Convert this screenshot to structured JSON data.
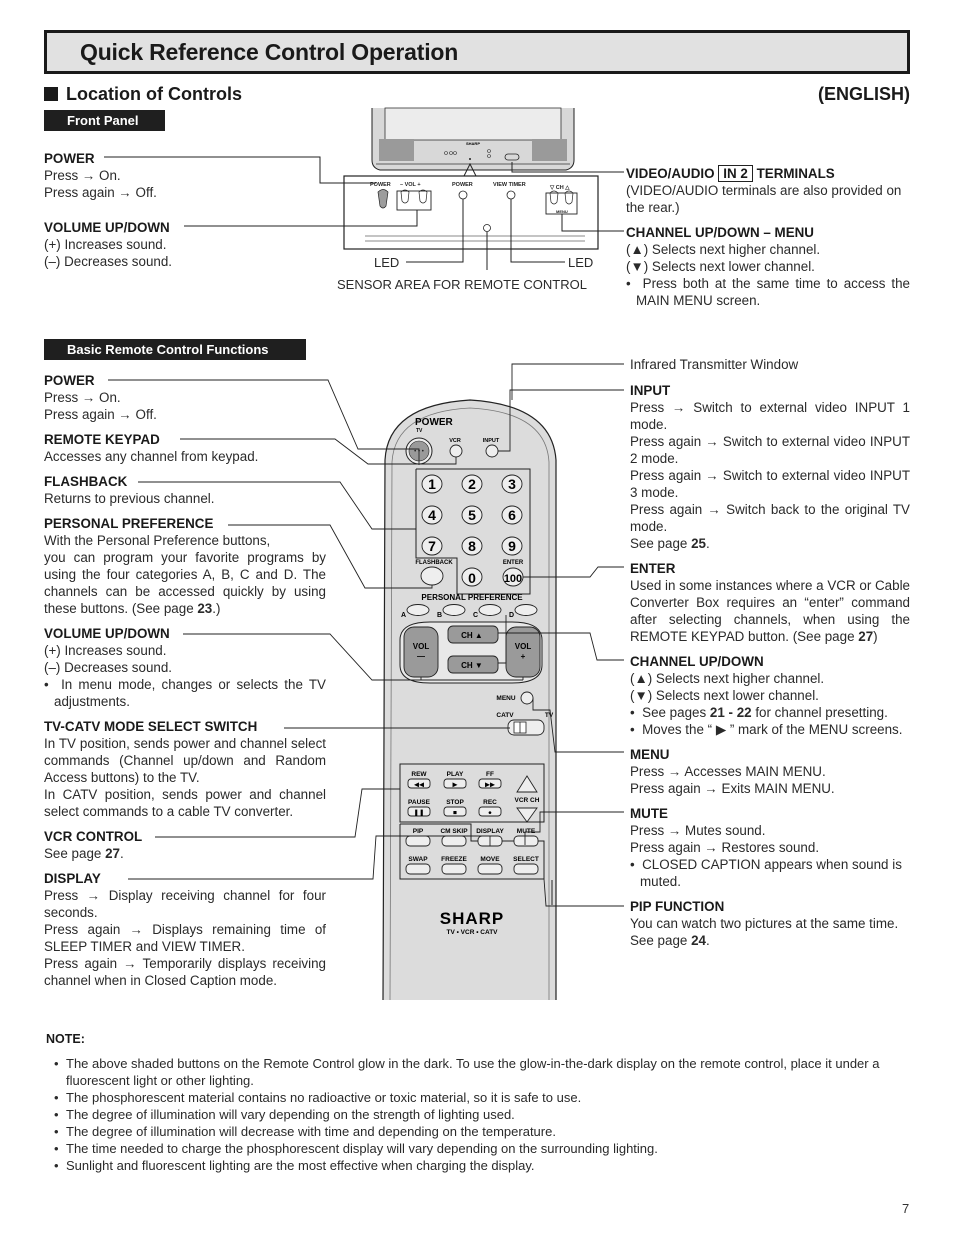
{
  "title": "Quick Reference Control Operation",
  "section": {
    "heading": "Location of Controls",
    "language": "(ENGLISH)"
  },
  "front_panel": {
    "tag": "Front Panel",
    "power": {
      "heading": "POWER",
      "lines": [
        "Press → On.",
        "Press again → Off."
      ]
    },
    "volume": {
      "heading": "VOLUME UP/DOWN",
      "lines": [
        "(+) Increases sound.",
        "(–) Decreases sound."
      ]
    },
    "video_audio": {
      "heading_pre": "VIDEO/AUDIO",
      "heading_box": "IN 2",
      "heading_post": "TERMINALS",
      "lines": [
        "(VIDEO/AUDIO terminals are also provided on the rear.)"
      ]
    },
    "channel": {
      "heading": "CHANNEL UP/DOWN – MENU",
      "lines": [
        "(▲) Selects next higher channel.",
        "(▼) Selects next lower channel."
      ],
      "bullet": "Press both at the same time to access the MAIN MENU screen."
    },
    "led_left": "LED",
    "led_right": "LED",
    "sensor": "SENSOR AREA FOR REMOTE CONTROL",
    "tv_labels": {
      "brand": "SHARP",
      "power": "POWER",
      "vol": "–  VOL +",
      "power_led": "POWER",
      "view_timer": "VIEW TIMER",
      "ch": "▽ CH △",
      "menu": "MENU"
    }
  },
  "remote": {
    "tag": "Basic Remote Control Functions",
    "left": [
      {
        "heading": "POWER",
        "lines": [
          "Press → On.",
          "Press again → Off."
        ]
      },
      {
        "heading": "REMOTE KEYPAD",
        "lines": [
          "Accesses any channel from keypad."
        ]
      },
      {
        "heading": "FLASHBACK",
        "lines": [
          "Returns to previous channel."
        ]
      },
      {
        "heading": "PERSONAL PREFERENCE",
        "lines": [
          "With the Personal Preference buttons,"
        ],
        "para": "you can program your favorite programs by using the four categories A, B, C and D. The channels can be accessed quickly by using these buttons. (See page ",
        "page": "23",
        "para_end": ".)"
      },
      {
        "heading": "VOLUME UP/DOWN",
        "lines": [
          "(+) Increases sound.",
          "(–) Decreases sound."
        ],
        "bullet": "In menu mode, changes or selects the TV adjustments."
      },
      {
        "heading": "TV-CATV MODE SELECT SWITCH",
        "para": "In TV position, sends power and channel select commands (Channel up/down and Random Access buttons) to the TV.",
        "para2": "In CATV position, sends power and channel select commands to a cable TV converter."
      },
      {
        "heading": "VCR CONTROL",
        "pre": "See page ",
        "page": "27",
        "post": "."
      },
      {
        "heading": "DISPLAY",
        "para": "Press → Display receiving channel for four seconds.",
        "para2": "Press again → Displays remaining time of SLEEP TIMER and VIEW TIMER.",
        "para3": "Press again → Temporarily displays receiving channel when in Closed Caption mode."
      }
    ],
    "right": [
      {
        "heading": "Infrared Transmitter Window"
      },
      {
        "heading": "INPUT",
        "paras": [
          "Press → Switch to external video INPUT 1 mode.",
          "Press again → Switch to external video INPUT 2 mode.",
          "Press again → Switch to external video INPUT 3 mode.",
          "Press again → Switch back to the original TV mode."
        ],
        "pre": "See page ",
        "page": "25",
        "post": "."
      },
      {
        "heading": "ENTER",
        "para": "Used in some instances where a VCR or Cable Converter Box requires an “enter” command after selecting channels, when using the REMOTE KEYPAD button. (See page ",
        "page": "27",
        "para_end": ")"
      },
      {
        "heading": "CHANNEL UP/DOWN",
        "lines": [
          "(▲) Selects next higher channel.",
          "(▼) Selects next lower channel."
        ],
        "bullet1_pre": "See pages ",
        "bullet1_page": "21 - 22",
        "bullet1_post": " for channel presetting.",
        "bullet2": "Moves the “ ▶ ” mark of the MENU screens."
      },
      {
        "heading": "MENU",
        "lines": [
          "Press → Accesses MAIN MENU.",
          "Press again → Exits MAIN MENU."
        ]
      },
      {
        "heading": "MUTE",
        "lines": [
          "Press → Mutes sound.",
          "Press again → Restores sound."
        ],
        "bullet": "CLOSED CAPTION appears when sound is muted."
      },
      {
        "heading": "PIP FUNCTION",
        "lines": [
          "You can watch two pictures at the same time."
        ],
        "pre": "See page ",
        "page": "24",
        "post": "."
      }
    ],
    "buttons": {
      "power": "POWER",
      "tv": "TV",
      "vcr": "VCR",
      "input": "INPUT",
      "digits": [
        "1",
        "2",
        "3",
        "4",
        "5",
        "6",
        "7",
        "8",
        "9"
      ],
      "zero": "0",
      "hundred": "100",
      "flashback": "FLASHBACK",
      "enter": "ENTER",
      "personal_preference": "PERSONAL PREFERENCE",
      "pp_keys": [
        "A",
        "B",
        "C",
        "D"
      ],
      "vol": "VOL",
      "vol_minus": "—",
      "vol_plus": "+",
      "ch_up": "CH ▲",
      "ch_down": "CH ▼",
      "menu": "MENU",
      "catv": "CATV",
      "tv_switch": "TV",
      "rew": "REW",
      "play": "PLAY",
      "ff": "FF",
      "pause": "PAUSE",
      "stop": "STOP",
      "rec": "REC",
      "vcr_ch": "VCR CH",
      "pip": "PIP",
      "cm_skip": "CM SKIP",
      "display": "DISPLAY",
      "mute": "MUTE",
      "swap": "SWAP",
      "freeze": "FREEZE",
      "move": "MOVE",
      "select": "SELECT",
      "brand": "SHARP",
      "brand_sub": "TV • VCR • CATV"
    }
  },
  "note": {
    "heading": "NOTE:",
    "items": [
      "The above shaded buttons on the Remote Control glow in the dark. To use the glow-in-the-dark display on the remote control, place it under a fluorescent light or other lighting.",
      "The phosphorescent material contains no radioactive or toxic material, so it is safe to use.",
      "The degree of illumination will vary depending on the strength of lighting used.",
      "The degree of illumination will decrease with time and depending on the temperature.",
      "The time needed to charge the phosphorescent display will vary depending on the surrounding lighting.",
      "Sunlight and fluorescent lighting are the most effective when charging the display."
    ]
  },
  "page_number": "7"
}
